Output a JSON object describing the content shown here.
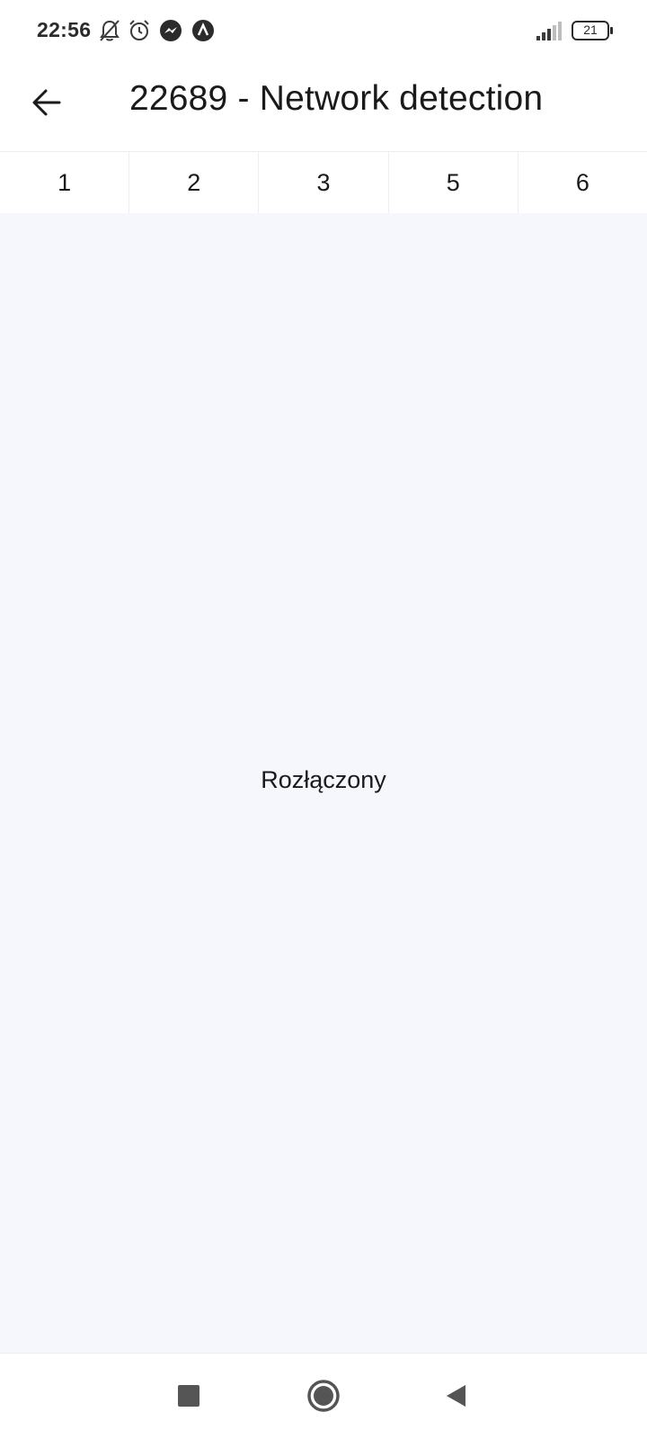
{
  "status_bar": {
    "time": "22:56",
    "icons": [
      "bell-off-icon",
      "alarm-clock-icon",
      "messenger-icon",
      "app-notification-icon"
    ],
    "signal_icon": "signal-bars-icon",
    "battery_level": "21"
  },
  "header": {
    "back_icon": "arrow-left-icon",
    "title": "22689 - Network detection"
  },
  "tabs": [
    {
      "label": "1"
    },
    {
      "label": "2"
    },
    {
      "label": "3"
    },
    {
      "label": "5"
    },
    {
      "label": "6"
    }
  ],
  "content": {
    "message": "Rozłączony",
    "background": "#f6f7fc"
  },
  "nav_bar": {
    "buttons": [
      "recents-square-icon",
      "home-circle-icon",
      "back-triangle-icon"
    ]
  }
}
